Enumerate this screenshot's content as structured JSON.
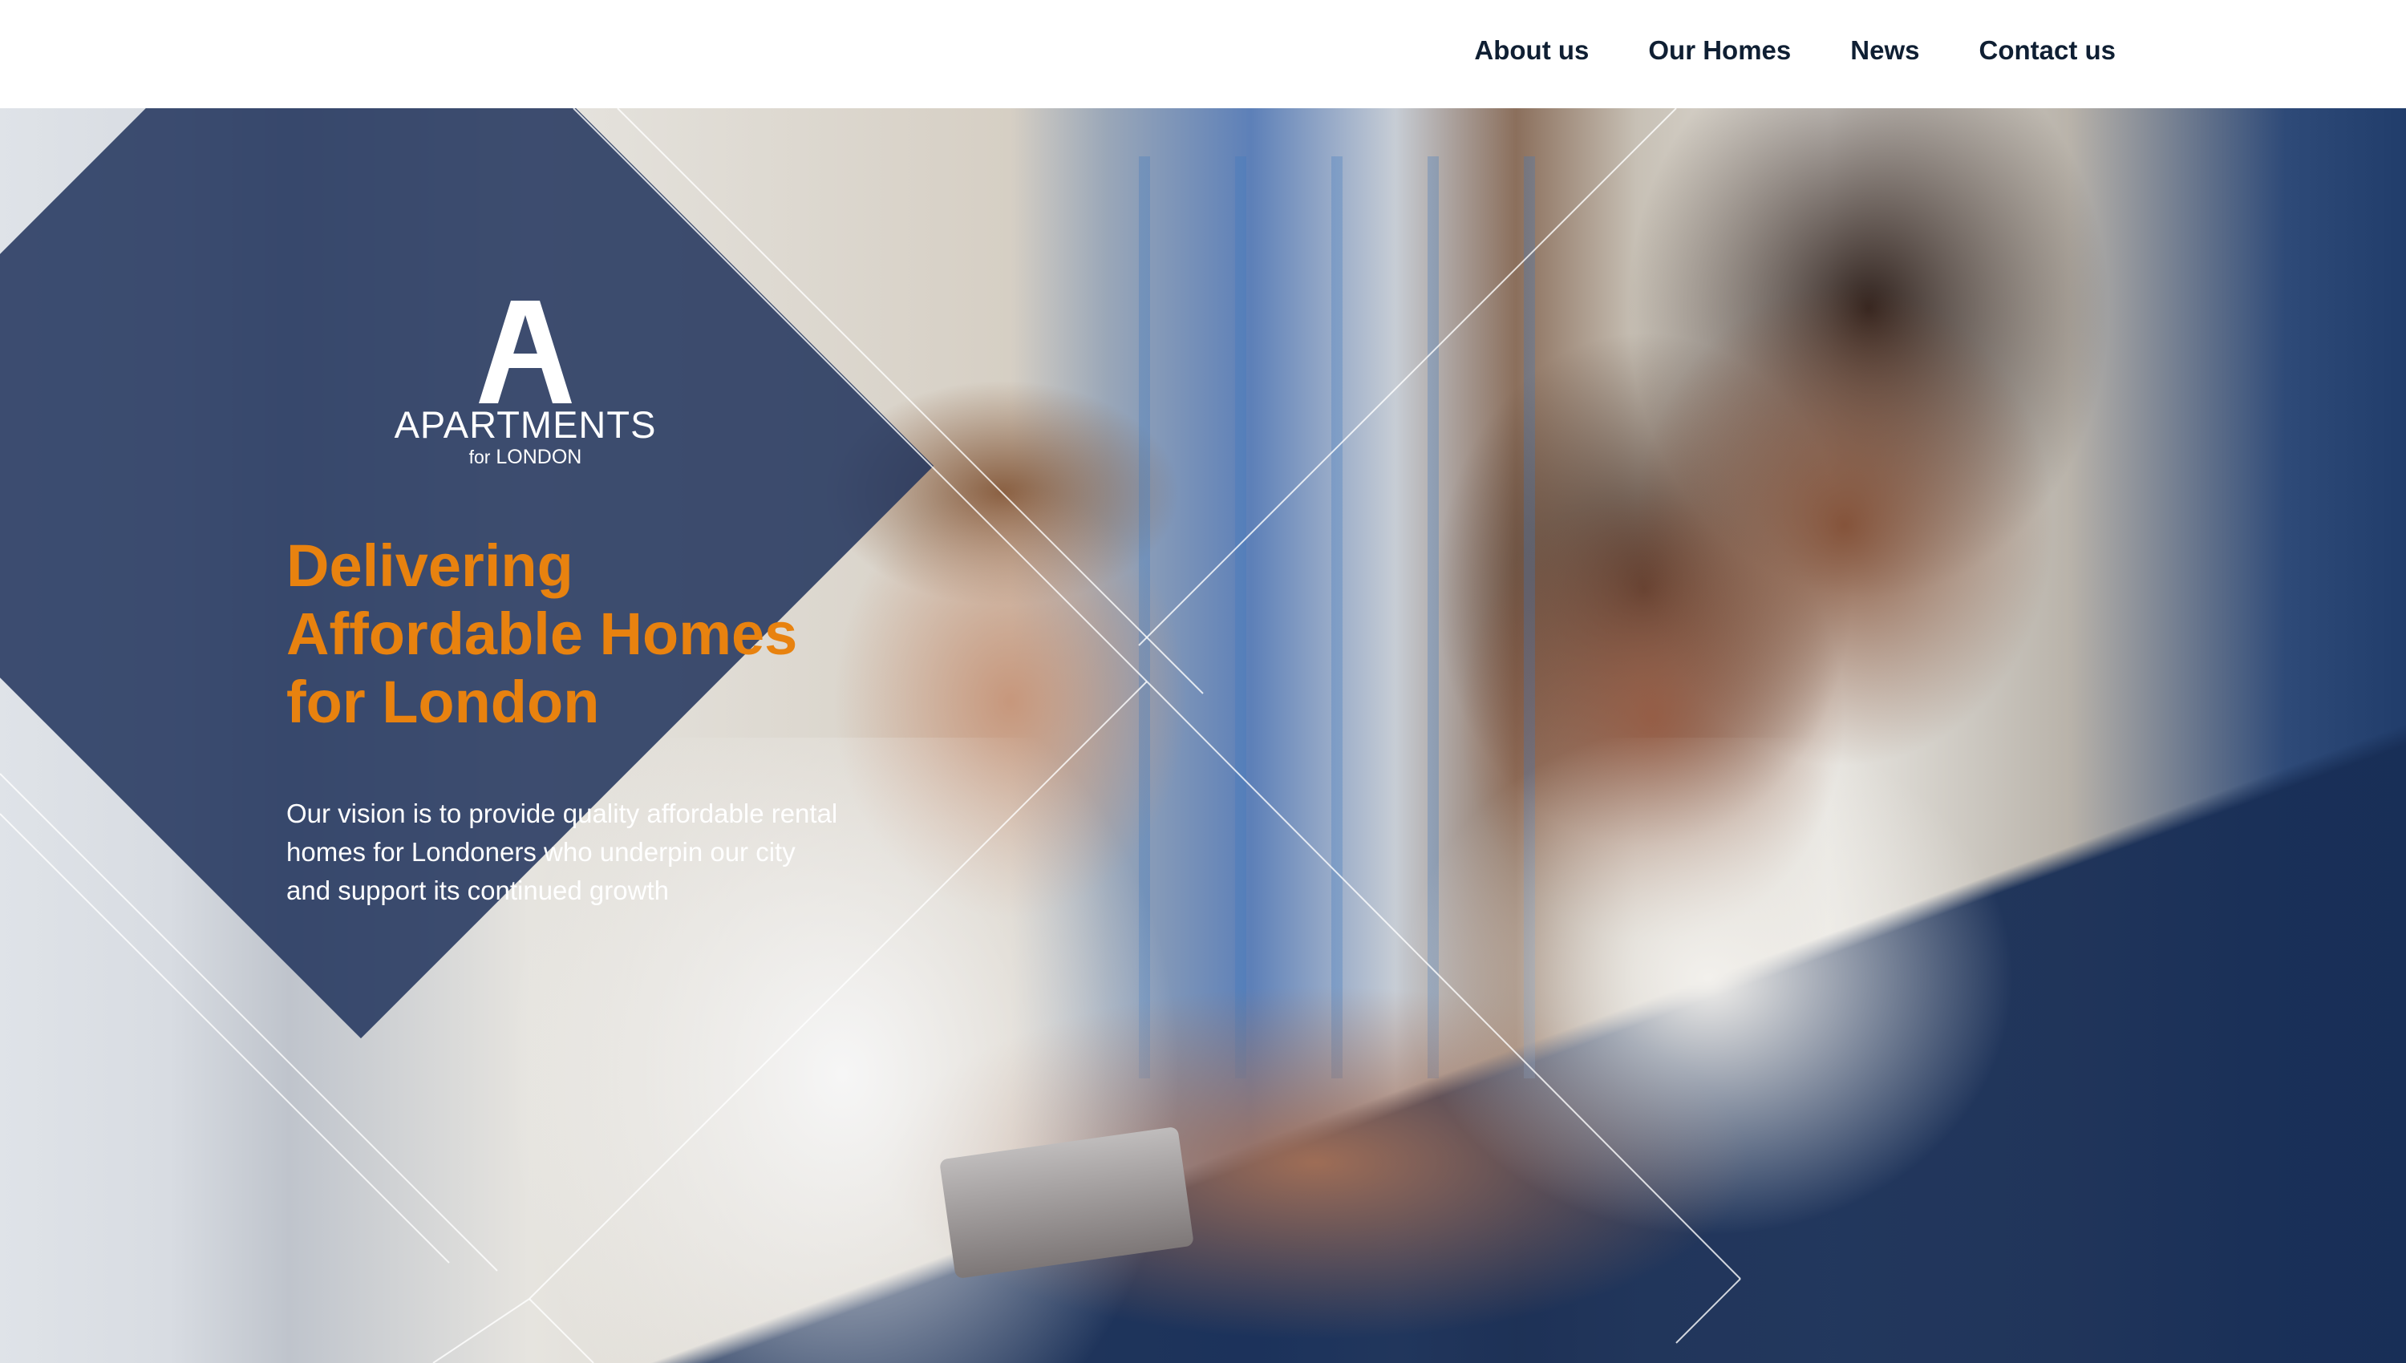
{
  "nav": {
    "items": [
      {
        "label": "About us"
      },
      {
        "label": "Our Homes"
      },
      {
        "label": "News"
      },
      {
        "label": "Contact us"
      }
    ]
  },
  "logo": {
    "name": "APARTMENTS",
    "sub_small": "for",
    "sub_big": "LONDON"
  },
  "hero": {
    "headline_lines": [
      "Delivering",
      "Affordable Homes",
      "for London"
    ],
    "intro_lines": [
      "Our vision is to provide quality affordable rental",
      "homes for Londoners who underpin our city",
      "and support its continued growth"
    ]
  },
  "colors": {
    "accent": "#e8820f",
    "navy": "#21335c",
    "nav_text": "#0f1f33"
  },
  "icons": {
    "logo_mark": "letter-a-mark"
  }
}
